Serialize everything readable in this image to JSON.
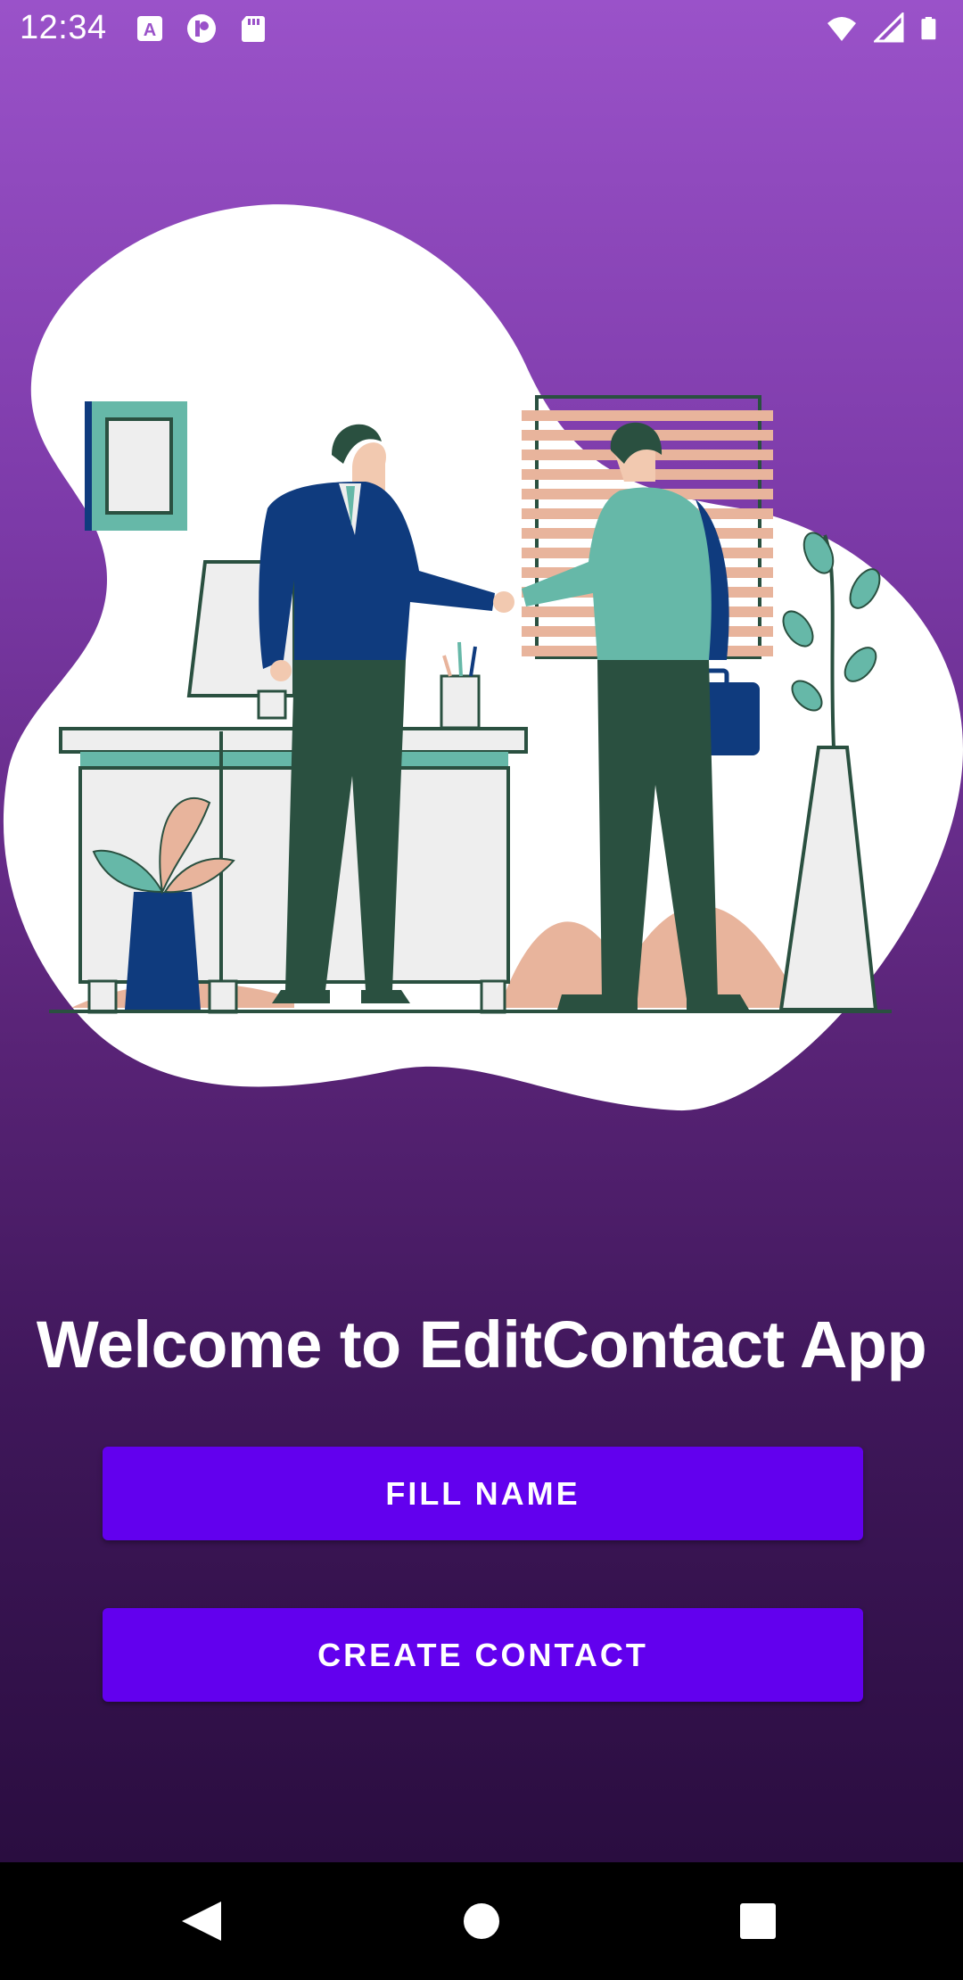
{
  "status_bar": {
    "time": "12:34",
    "left_icons": [
      "app-a-icon",
      "app-p-icon",
      "sd-card-icon"
    ],
    "right_icons": [
      "wifi-icon",
      "cell-signal-icon",
      "battery-icon"
    ]
  },
  "illustration": {
    "icon": "handshake-office-illustration",
    "colors": {
      "blob": "#ffffff",
      "navy": "#0f3b7e",
      "teal": "#66b8a8",
      "dark_green": "#2a5040",
      "peach": "#e8b49c"
    }
  },
  "main": {
    "title": "Welcome to EditContact App",
    "fill_name_label": "FILL NAME",
    "create_contact_label": "CREATE CONTACT"
  },
  "nav_bar": {
    "back": "back-icon",
    "home": "home-icon",
    "recents": "recents-icon"
  },
  "colors": {
    "button": "#6200ee",
    "gradient_top": "#9a52c9",
    "gradient_bottom": "#2a0d40"
  }
}
